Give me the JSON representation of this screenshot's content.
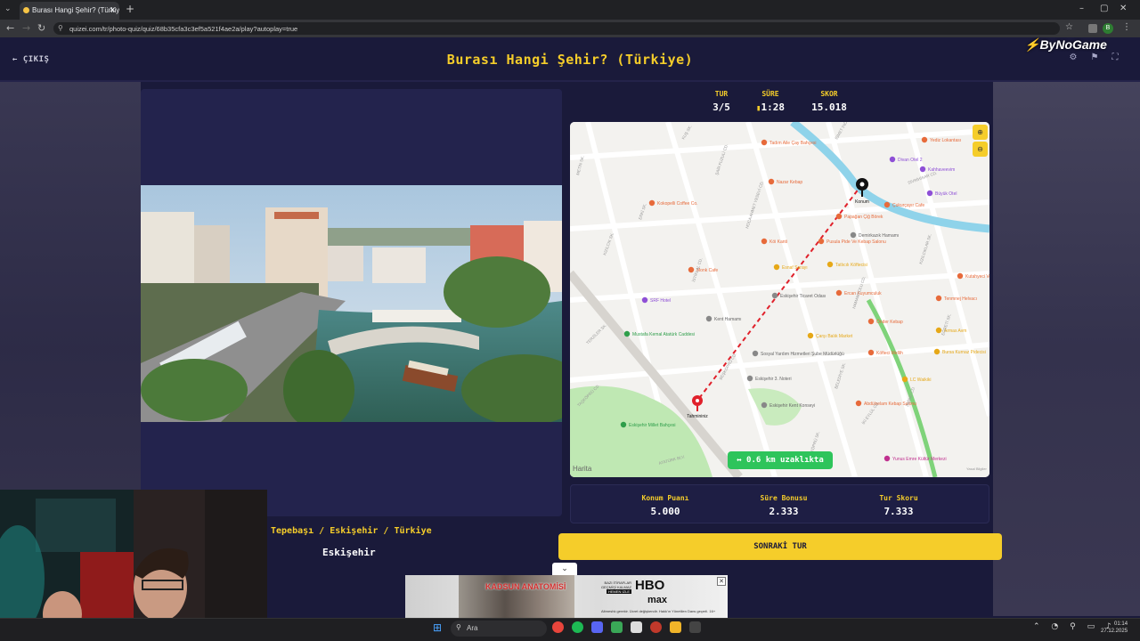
{
  "browser": {
    "tab_title": "Burası Hangi Şehir? (Türkiye) - Q",
    "url": "quizei.com/tr/photo-quiz/quiz/68b35cfa3c3ef5a521f4ae2a/play?autoplay=true",
    "ext_badge": "B"
  },
  "header": {
    "exit_label": "ÇIKIŞ",
    "title": "Burası Hangi Şehir? (Türkiye)",
    "brand_a": "By",
    "brand_b": "NoGame"
  },
  "stats": {
    "round_label": "TUR",
    "round_value": "3/5",
    "time_label": "SÜRE",
    "time_value": "1:28",
    "score_label": "SKOR",
    "score_value": "15.018"
  },
  "map": {
    "distance": "↔ 0.6 km uzaklıkta",
    "attribution": "Harita",
    "legal": "Yasal Bilgiler",
    "pin_actual": "Konum",
    "pin_guess": "Tahmininiz",
    "labels": [
      "Tadım Aile Çay Bahçesi",
      "Yediz Lokantası",
      "Divan Otel 2",
      "Kahhaveevim",
      "Büyük Otel",
      "Nazar Kebap",
      "Kokopelli Coffee Co.",
      "Çukurçayır Cafe",
      "Papağan Çiğ Börek",
      "Köi Kanti",
      "Pusula Pide Ve Kebap Salonu",
      "Demirkazık Hamamı",
      "Esnaf Sarayı",
      "Tatlıcılı Köftecisi",
      "Monk Cafe",
      "Kutahyeci Volkan",
      "SRF Hotel",
      "Kent Hamamı",
      "Eskişehir Ticaret Odası",
      "Ercan Kuyumculuk",
      "Tenmnej Helvacı",
      "Mustafa Kemal Atatürk Caddesi",
      "Çarşı Balık Market",
      "Önder Kebap",
      "Armas Avm",
      "Sosyal Yardım Hizmetleri Şube Müdürlüğü",
      "Köfteci Mellih",
      "Bursa Kurnaz Pidecisi",
      "Eskişehir 3. Noteri",
      "LC Waikiki",
      "Eskişehir Kent Konseyi",
      "Abdülselam Kebap Salonu",
      "Eskişehir Millet Bahçesi",
      "Yunus Emre Kültür Merkezi"
    ],
    "streets": [
      "KUŞ SK.",
      "METİN SK.",
      "ŞAİR FUZULİ CD.",
      "İSMET İNÖNÜ CD.",
      "SİVRİHİSAR CD.",
      "ERKİ SK.",
      "KIZILCIK SK.",
      "HOCA AHMET YESEVİ CD.",
      "İSTİKLAL CD.",
      "BEŞKÖPRÜ CD.",
      "TERZİLER SK.",
      "TAŞKÖPRÜ CD.",
      "BEŞKÖPRÜ SK.",
      "HAMAMYOLU CD.",
      "BELEDİYE SK.",
      "İKİ EYLÜL CD.",
      "İNÖNÜ CD.",
      "ATATÜRK BLV.",
      "KIZILCIKLAR SK.",
      "EĞRETİ SK."
    ]
  },
  "scores": {
    "location_label": "Konum Puanı",
    "location_value": "5.000",
    "time_label": "Süre Bonusu",
    "time_value": "2.333",
    "round_label": "Tur Skoru",
    "round_value": "7.333"
  },
  "next_button": "SONRAKİ TUR",
  "answer": {
    "path": "Tepebaşı / Eskişehir / Türkiye",
    "city": "Eskişehir"
  },
  "ad": {
    "title": "KADSUN ANATOMİSİ",
    "side": "BAZI İTİRAFLAR GEÇMİŞİ KALMAZ",
    "side2": "HEMEN İZLE",
    "logo1": "HBO",
    "logo2": "max",
    "sub": "Altmeshk gerekir. Ücret değişkendir. Hakk'ın Yönetilen Dans geçerli. 16+"
  },
  "taskbar": {
    "search": "Ara",
    "time": "01:14",
    "date": "27.12.2025"
  }
}
